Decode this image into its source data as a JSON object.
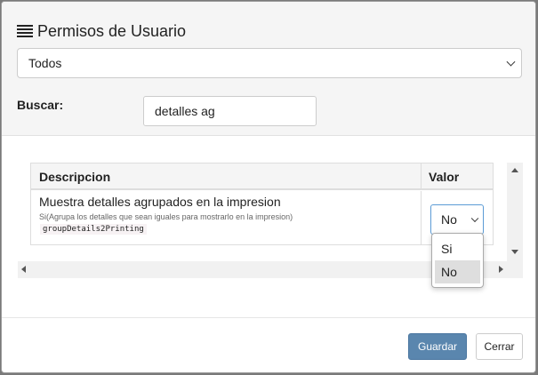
{
  "modal": {
    "title": "Permisos de Usuario",
    "title_icon": "hamburger-list-icon",
    "filter_select": {
      "value": "Todos"
    },
    "search": {
      "label": "Buscar:",
      "value": "detalles ag"
    }
  },
  "table": {
    "headers": {
      "description": "Descripcion",
      "value": "Valor"
    },
    "rows": [
      {
        "title": "Muestra detalles agrupados en la impresion",
        "subtitle": "Si(Agrupa los detalles que sean iguales para mostrarlo en la impresion)",
        "code": "groupDetails2Printing",
        "value": "No"
      }
    ]
  },
  "dropdown": {
    "options": [
      "Si",
      "No"
    ],
    "highlighted": "No"
  },
  "footer": {
    "save_label": "Guardar",
    "close_label": "Cerrar"
  },
  "colors": {
    "primary_button": "#5a86ae",
    "focus_border": "#5b9bd5"
  }
}
